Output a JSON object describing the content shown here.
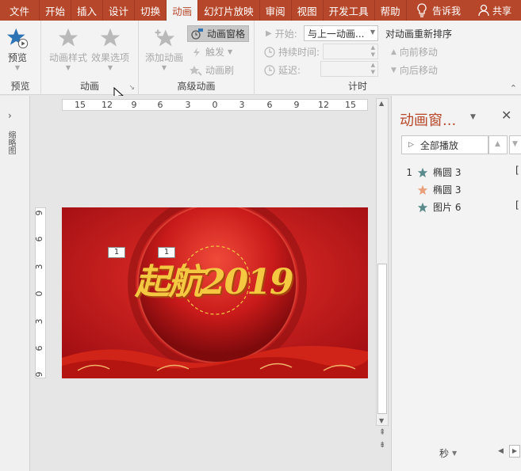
{
  "tabs": [
    "文件",
    "开始",
    "插入",
    "设计",
    "切换",
    "动画",
    "幻灯片放映",
    "审阅",
    "视图",
    "开发工具",
    "帮助"
  ],
  "tell_me": "告诉我",
  "share": "共享",
  "ribbon": {
    "preview": {
      "btn": "预览",
      "group": "预览"
    },
    "animation": {
      "style": "动画样式",
      "effect": "效果选项",
      "group": "动画"
    },
    "advanced": {
      "add": "添加动画",
      "pane": "动画窗格",
      "trigger": "触发",
      "painter": "动画刷",
      "group": "高级动画"
    },
    "timing": {
      "start_label": "开始:",
      "start_value": "与上一动画...",
      "duration_label": "持续时间:",
      "delay_label": "延迟:",
      "reorder_title": "对动画重新排序",
      "move_earlier": "向前移动",
      "move_later": "向后移动",
      "group": "计时"
    }
  },
  "left_pane": {
    "label": "缩略图"
  },
  "ruler": {
    "h": [
      "15",
      "12",
      "9",
      "6",
      "3",
      "0",
      "3",
      "6",
      "9",
      "12",
      "15"
    ],
    "v": [
      "9",
      "6",
      "3",
      "0",
      "3",
      "6",
      "9"
    ]
  },
  "slide": {
    "title_text": "起航2019",
    "tag1": "1",
    "tag2": "1"
  },
  "anim_pane": {
    "title": "动画窗...",
    "play_all": "全部播放",
    "items": [
      {
        "num": "1",
        "name": "椭圆 3",
        "color": "#5b8a8a"
      },
      {
        "num": "",
        "name": "椭圆 3",
        "color": "#e8a07a"
      },
      {
        "num": "",
        "name": "图片 6",
        "color": "#5b8a8a"
      }
    ],
    "seconds": "秒"
  },
  "colors": {
    "accent": "#b7472a",
    "slide_red": "#c51a1a",
    "gold": "#f5c842"
  }
}
